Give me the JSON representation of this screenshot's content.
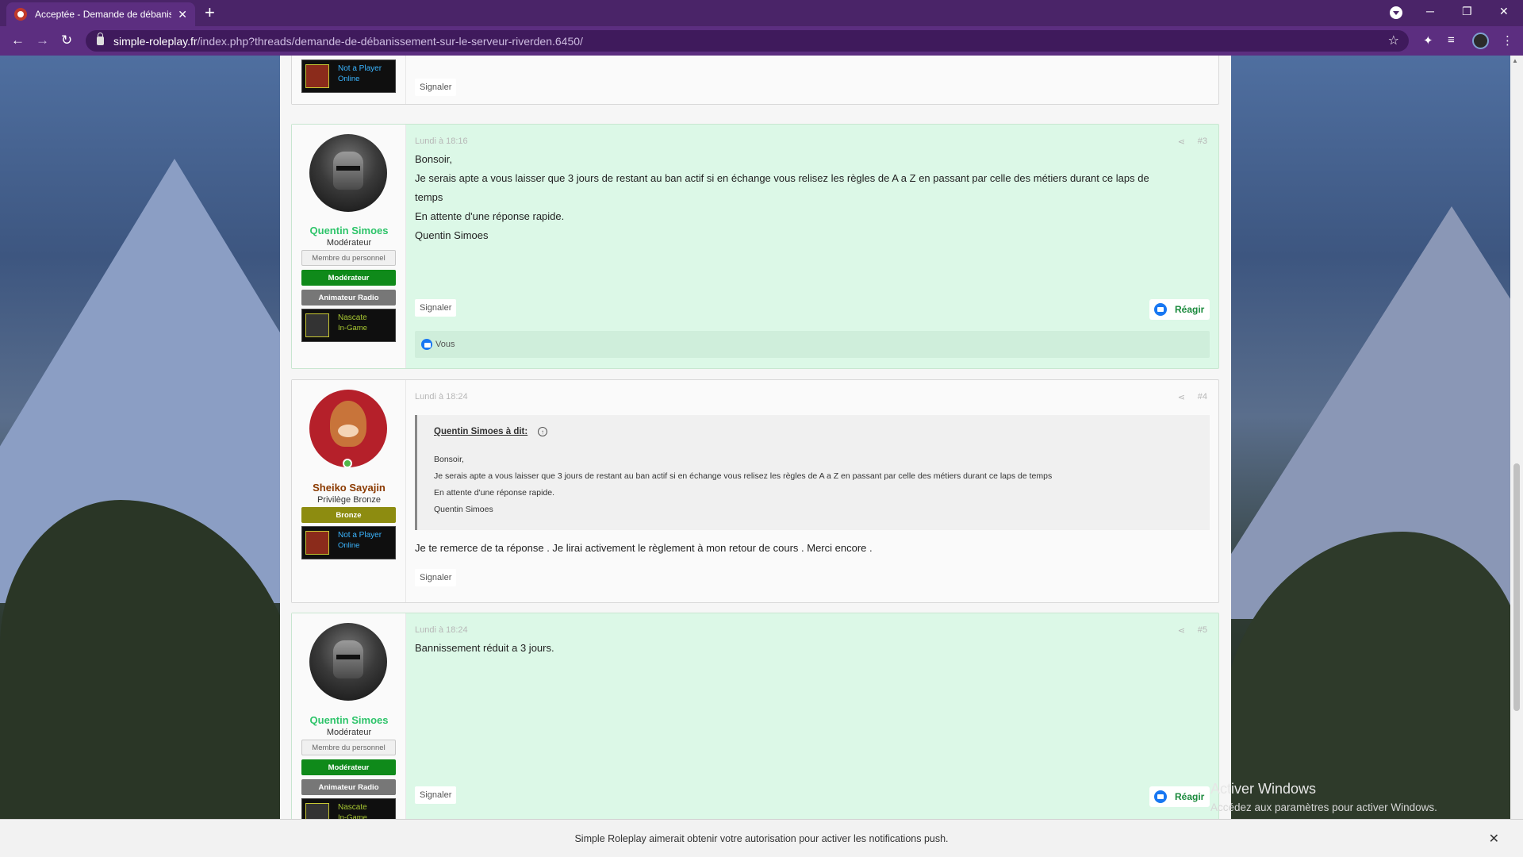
{
  "browser": {
    "tab_title": "Acceptée - Demande de débanis",
    "tab_close": "✕",
    "new_tab": "+",
    "url_host": "simple-roleplay.fr",
    "url_path": "/index.php?threads/demande-de-débanissement-sur-le-serveur-riverden.6450/",
    "controls": {
      "minimize": "─",
      "restore": "❐",
      "close": "✕"
    }
  },
  "posts": {
    "p2": {
      "status_name": "Not a Player",
      "status_state": "Online",
      "signal": "Signaler"
    },
    "p3": {
      "author": "Quentin Simoes",
      "title": "Modérateur",
      "badges": [
        "Membre du personnel",
        "Modérateur",
        "Animateur Radio"
      ],
      "status_name": "Nascate",
      "status_state": "In-Game",
      "date": "Lundi à 18:16",
      "number": "#3",
      "lines": [
        "Bonsoir,",
        "Je serais apte a vous laisser que 3 jours de restant au ban actif si en échange vous relisez les règles de A a Z en passant par celle des métiers durant ce laps de",
        "temps",
        "En attente d'une réponse rapide.",
        "Quentin Simoes"
      ],
      "signal": "Signaler",
      "react": "Réagir",
      "reactions": "Vous"
    },
    "p4": {
      "author": "Sheiko Sayajin",
      "title": "Privilège Bronze",
      "badges": [
        "Bronze"
      ],
      "status_name": "Not a Player",
      "status_state": "Online",
      "date": "Lundi à 18:24",
      "number": "#4",
      "quote_head": "Quentin Simoes à dit:",
      "quote_lines": [
        "Bonsoir,",
        "Je serais apte a vous laisser que 3 jours de restant au ban actif si en échange vous relisez les règles de A a Z en passant par celle des métiers durant ce laps de temps",
        "En attente d'une réponse rapide.",
        "Quentin Simoes"
      ],
      "message": "Je te remerce de ta réponse . Je lirai activement le règlement à mon retour de cours . Merci encore .",
      "signal": "Signaler"
    },
    "p5": {
      "author": "Quentin Simoes",
      "title": "Modérateur",
      "badges": [
        "Membre du personnel",
        "Modérateur",
        "Animateur Radio"
      ],
      "status_name": "Nascate",
      "status_state": "In-Game",
      "date": "Lundi à 18:24",
      "number": "#5",
      "message": "Bannissement réduit a 3 jours.",
      "signal": "Signaler",
      "react": "Réagir"
    }
  },
  "windows_watermark": {
    "line1": "Activer Windows",
    "line2": "Accédez aux paramètres pour activer Windows."
  },
  "notification": {
    "text": "Simple Roleplay aimerait obtenir votre autorisation pour activer les notifications push.",
    "close": "✕"
  },
  "colors": {
    "chrome": "#5c2e80",
    "highlight_post": "#dcf8e7",
    "moderator_badge": "#0f8a1a",
    "bronze_badge": "#8d8c10",
    "author_green": "#2ec46a"
  }
}
